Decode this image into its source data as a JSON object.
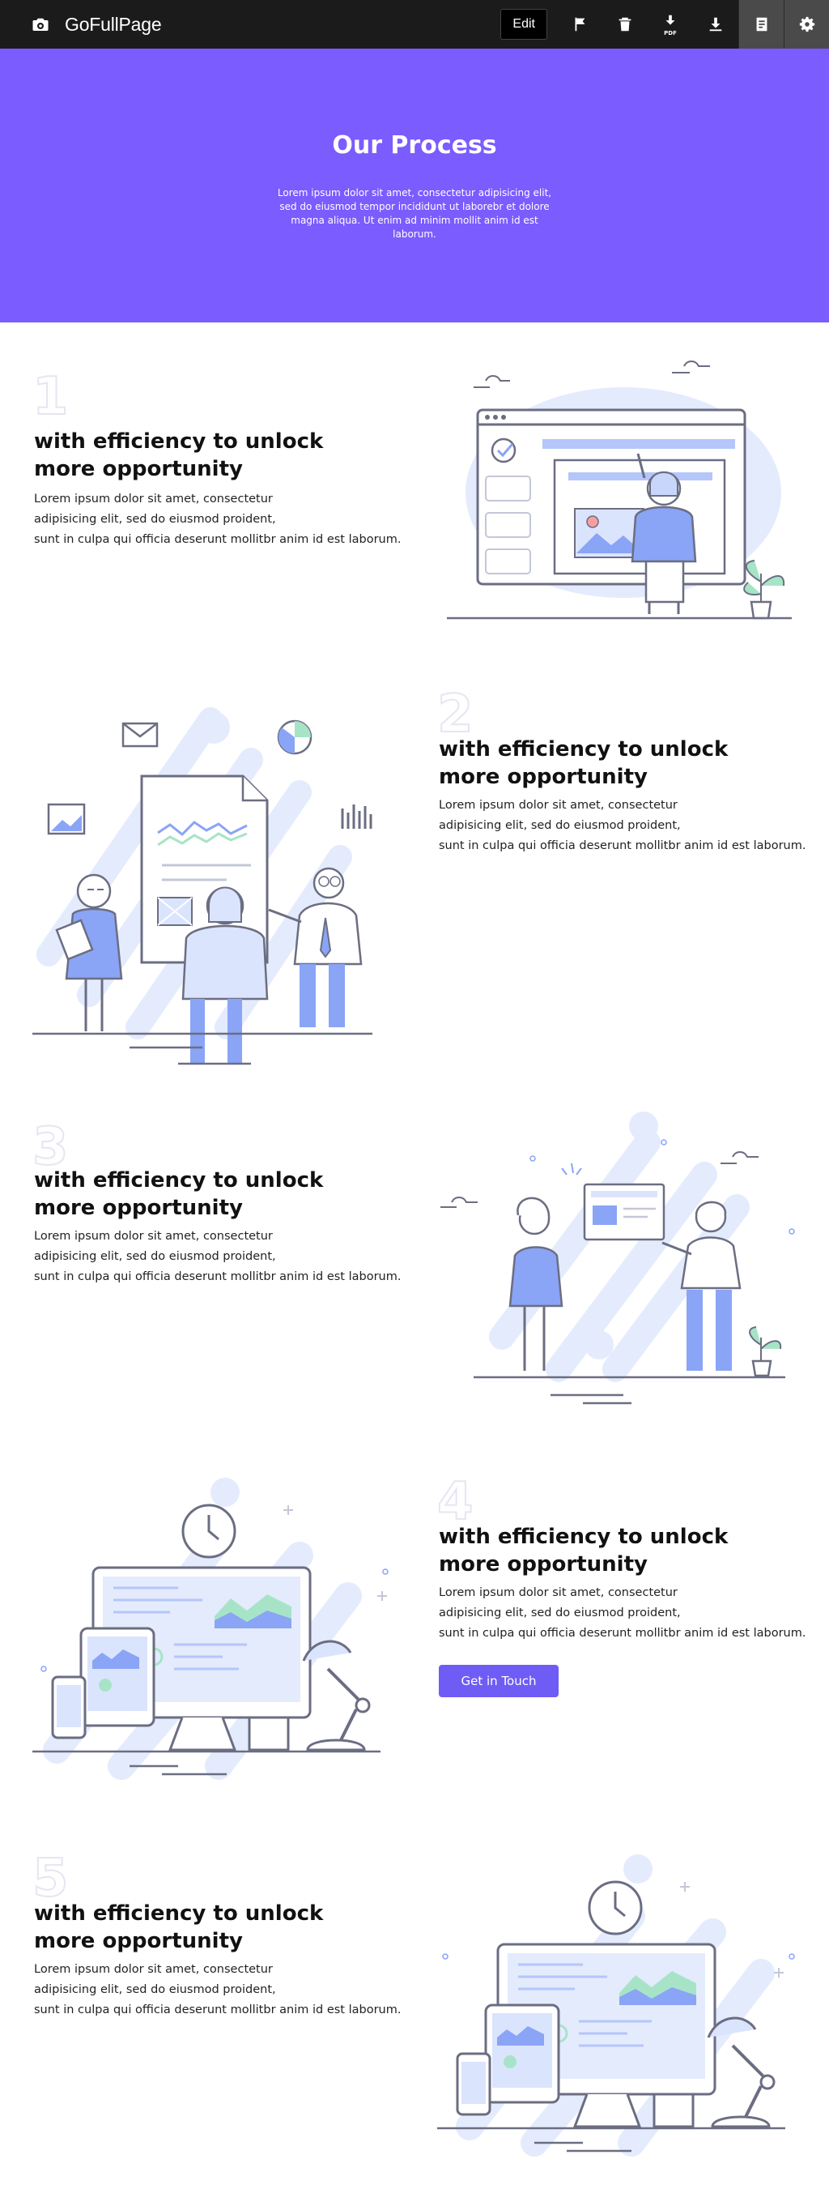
{
  "toolbar": {
    "brand": "GoFullPage",
    "edit_label": "Edit",
    "tools": [
      "flag-icon",
      "trash-icon",
      "pdf-download-icon",
      "download-icon",
      "document-icon",
      "gear-icon"
    ],
    "pdf_label": "PDF"
  },
  "hero": {
    "title": "Our Process",
    "subtitle": "Lorem ipsum dolor sit amet, consectetur adipisicing elit, sed do eiusmod tempor incididunt ut laborebr et dolore magna aliqua. Ut enim ad minim mollit anim id est laborum."
  },
  "steps": [
    {
      "number": "1",
      "title": "with efficiency to unlock more opportunity",
      "line1": "Lorem ipsum dolor sit amet, consectetur",
      "line2": "adipisicing elit, sed do eiusmod proident,",
      "line3": "sunt in culpa qui officia deserunt mollitbr anim id est laborum."
    },
    {
      "number": "2",
      "title": "with efficiency to unlock more opportunity",
      "line1": "Lorem ipsum dolor sit amet, consectetur",
      "line2": "adipisicing elit, sed do eiusmod proident,",
      "line3": "sunt in culpa qui officia deserunt mollitbr anim id est laborum."
    },
    {
      "number": "3",
      "title": "with efficiency to unlock more opportunity",
      "line1": "Lorem ipsum dolor sit amet, consectetur",
      "line2": "adipisicing elit, sed do eiusmod proident,",
      "line3": "sunt in culpa qui officia deserunt mollitbr anim id est laborum."
    },
    {
      "number": "4",
      "title": "with efficiency to unlock more opportunity",
      "line1": "Lorem ipsum dolor sit amet, consectetur",
      "line2": "adipisicing elit, sed do eiusmod proident,",
      "line3": "sunt in culpa qui officia deserunt mollitbr anim id est laborum.",
      "button": "Get in Touch"
    },
    {
      "number": "5",
      "title": "with efficiency to unlock more opportunity",
      "line1": "Lorem ipsum dolor sit amet, consectetur",
      "line2": "adipisicing elit, sed do eiusmod proident,",
      "line3": "sunt in culpa qui officia deserunt mollitbr anim id est laborum."
    }
  ],
  "colors": {
    "hero": "#7a5cff",
    "accent": "#6f5cf5",
    "illustration_blue": "#8aa4f6",
    "illustration_light": "#e4ebfd",
    "line": "#6b6e82"
  }
}
